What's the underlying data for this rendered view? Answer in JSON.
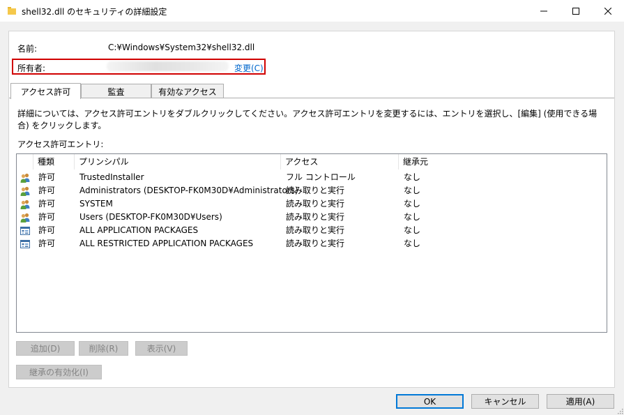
{
  "window": {
    "title": "shell32.dll のセキュリティの詳細設定"
  },
  "fields": {
    "name_label": "名前:",
    "name_value": "C:¥Windows¥System32¥shell32.dll",
    "owner_label": "所有者:",
    "owner_change": "変更(C)"
  },
  "tabs": [
    "アクセス許可",
    "監査",
    "有効なアクセス"
  ],
  "description": "詳細については、アクセス許可エントリをダブルクリックしてください。アクセス許可エントリを変更するには、エントリを選択し、[編集] (使用できる場合) をクリックします。",
  "entries_label": "アクセス許可エントリ:",
  "table": {
    "headers": [
      "種類",
      "プリンシパル",
      "アクセス",
      "継承元"
    ],
    "rows": [
      {
        "icon": "users-icon",
        "type": "許可",
        "principal": "TrustedInstaller",
        "access": "フル コントロール",
        "inherited": "なし"
      },
      {
        "icon": "users-icon",
        "type": "許可",
        "principal": "Administrators (DESKTOP-FK0M30D¥Administrators)",
        "access": "読み取りと実行",
        "inherited": "なし"
      },
      {
        "icon": "users-icon",
        "type": "許可",
        "principal": "SYSTEM",
        "access": "読み取りと実行",
        "inherited": "なし"
      },
      {
        "icon": "users-icon",
        "type": "許可",
        "principal": "Users (DESKTOP-FK0M30D¥Users)",
        "access": "読み取りと実行",
        "inherited": "なし"
      },
      {
        "icon": "app-package-icon",
        "type": "許可",
        "principal": "ALL APPLICATION PACKAGES",
        "access": "読み取りと実行",
        "inherited": "なし"
      },
      {
        "icon": "app-package-icon",
        "type": "許可",
        "principal": "ALL RESTRICTED APPLICATION PACKAGES",
        "access": "読み取りと実行",
        "inherited": "なし"
      }
    ]
  },
  "buttons": {
    "add": "追加(D)",
    "remove": "削除(R)",
    "view": "表示(V)",
    "enable_inheritance": "継承の有効化(I)"
  },
  "footer": {
    "ok": "OK",
    "cancel": "キャンセル",
    "apply": "適用(A)"
  },
  "colors": {
    "owner_highlight": "#d00000",
    "link": "#0066cc",
    "default_button_border": "#0078d7"
  }
}
